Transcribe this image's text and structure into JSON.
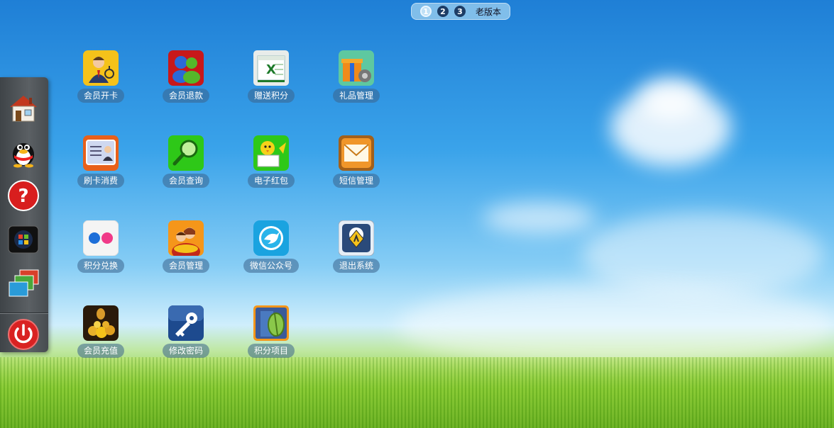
{
  "pager": {
    "pages": [
      "1",
      "2",
      "3"
    ],
    "active_page": "1",
    "old_version_label": "老版本"
  },
  "dock": [
    {
      "icon": "home-icon"
    },
    {
      "icon": "qq-penguin-icon"
    },
    {
      "icon": "help-icon"
    },
    {
      "icon": "windows-icon"
    },
    {
      "icon": "windows-stack-icon"
    },
    {
      "icon": "power-icon"
    }
  ],
  "apps": [
    {
      "label": "会员开卡",
      "icon": "member-card-icon"
    },
    {
      "label": "会员退款",
      "icon": "member-refund-icon"
    },
    {
      "label": "赠送积分",
      "icon": "excel-points-icon"
    },
    {
      "label": "礼品管理",
      "icon": "gift-management-icon"
    },
    {
      "label": "刷卡消费",
      "icon": "swipe-card-icon"
    },
    {
      "label": "会员查询",
      "icon": "search-icon"
    },
    {
      "label": "电子红包",
      "icon": "red-envelope-icon"
    },
    {
      "label": "短信管理",
      "icon": "envelope-icon"
    },
    {
      "label": "积分兑换",
      "icon": "flickr-dots-icon"
    },
    {
      "label": "会员管理",
      "icon": "member-management-icon"
    },
    {
      "label": "微信公众号",
      "icon": "bird-icon"
    },
    {
      "label": "退出系统",
      "icon": "exit-system-icon"
    },
    {
      "label": "会员充值",
      "icon": "coins-icon"
    },
    {
      "label": "修改密码",
      "icon": "key-icon"
    },
    {
      "label": "积分项目",
      "icon": "points-project-icon"
    }
  ]
}
